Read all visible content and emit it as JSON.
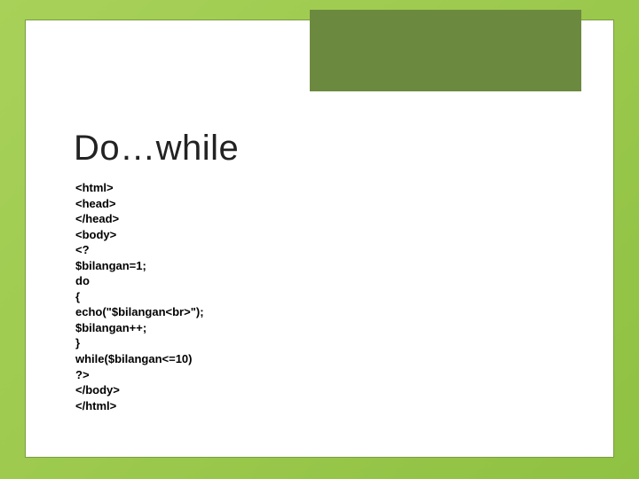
{
  "title": "Do…while",
  "code": {
    "l1": "<html>",
    "l2": "<head>",
    "l3": "</head>",
    "l4": "<body>",
    "l5": "<?",
    "l6": "$bilangan=1;",
    "l7": "do",
    "l8": "{",
    "l9": "echo(\"$bilangan<br>\");",
    "l10": "$bilangan++;",
    "l11": "}",
    "l12": "while($bilangan<=10)",
    "l13": "?>",
    "l14": "</body>",
    "l15": "</html>"
  }
}
